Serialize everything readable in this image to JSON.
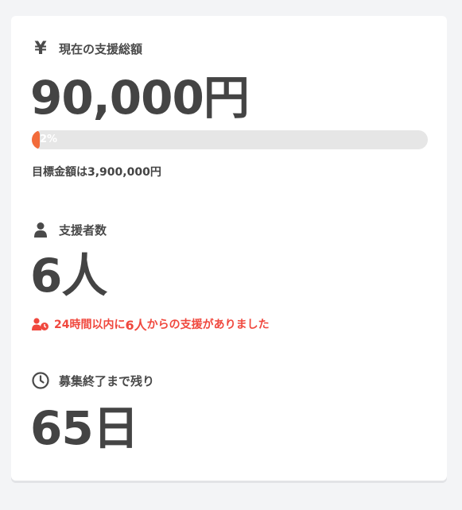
{
  "funding": {
    "label": "現在の支援総額",
    "amount": "90,000円",
    "progress_percent": 2,
    "progress_label": "2%",
    "goal_text": "目標金額は3,900,000円",
    "icon": "yen-icon"
  },
  "supporters": {
    "label": "支援者数",
    "count": "6人",
    "icon": "user-icon",
    "recent": {
      "prefix": "24時間以内に",
      "count": "6人",
      "suffix": "からの支援がありました",
      "icon": "user-clock-icon"
    }
  },
  "remaining": {
    "label": "募集終了まで残り",
    "days": "65日",
    "icon": "clock-icon"
  },
  "colors": {
    "accent": "#f26b3a",
    "alert": "#f0483e",
    "text": "#444444",
    "track": "#e6e6e6"
  }
}
